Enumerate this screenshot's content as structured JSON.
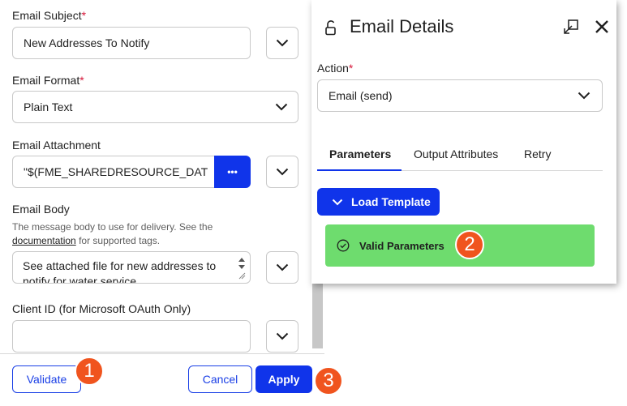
{
  "form": {
    "subject": {
      "label": "Email Subject",
      "required": "*",
      "value": "New Addresses To Notify"
    },
    "format": {
      "label": "Email Format",
      "required": "*",
      "value": "Plain Text"
    },
    "attachment": {
      "label": "Email Attachment",
      "value": "\"$(FME_SHAREDRESOURCE_DAT",
      "more_label": "•••"
    },
    "body": {
      "label": "Email Body",
      "help_prefix": "The message body to use for delivery. See the",
      "help_link": "documentation",
      "help_suffix": "for supported tags.",
      "value_line1": "See attached file for new addresses to",
      "value_line2": "notify for water service."
    },
    "client_id": {
      "label": "Client ID (for Microsoft OAuth Only)",
      "value": ""
    }
  },
  "footer": {
    "validate_label": "Validate",
    "cancel_label": "Cancel",
    "apply_label": "Apply"
  },
  "callouts": {
    "one": "1",
    "two": "2",
    "three": "3"
  },
  "panel": {
    "title": "Email Details",
    "action_label": "Action",
    "action_required": "*",
    "action_value": "Email (send)",
    "tabs": [
      "Parameters",
      "Output Attributes",
      "Retry"
    ],
    "active_tab": "Parameters",
    "load_template_label": "Load Template",
    "status_text": "Valid Parameters"
  },
  "icons": {
    "panel_lock": "unlock-icon",
    "panel_popout": "pop-out-icon",
    "panel_close": "close-icon",
    "status": "check-circle-icon"
  },
  "colors": {
    "primary": "#1034ea",
    "required": "#d6183a",
    "callout": "#f0541e",
    "success": "#6edc6e"
  }
}
